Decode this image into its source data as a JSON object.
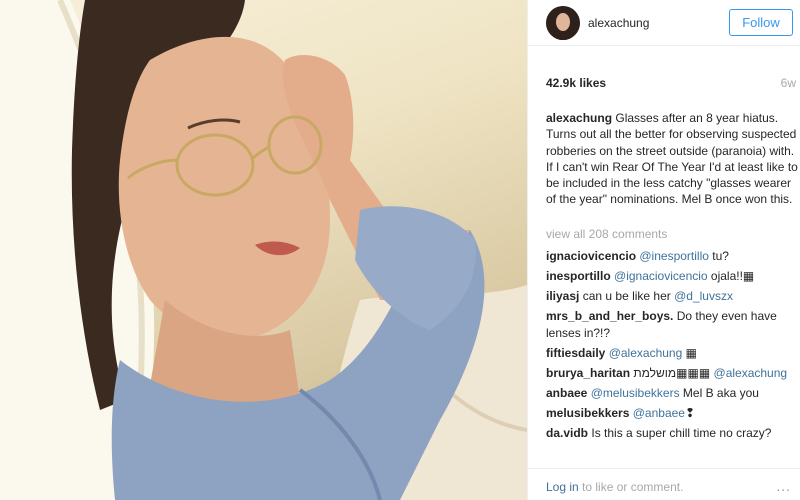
{
  "post": {
    "username": "alexachung",
    "follow_label": "Follow",
    "likes": "42.9k likes",
    "time_ago": "6w",
    "caption": {
      "user": "alexachung",
      "text": "Glasses after an 8 year hiatus. Turns out all the better for observing suspected robberies on the street outside (paranoia) with. If I can't win Rear Of The Year I'd at least like to be included in the less catchy \"glasses wearer of the year\" nominations. Mel B once won this."
    },
    "view_all": "view all 208 comments",
    "comments": [
      {
        "user": "ignaciovicencio",
        "mention": "@inesportillo",
        "text": " tu?"
      },
      {
        "user": "inesportillo",
        "mention": "@ignaciovicencio",
        "text": " ojala!!▦"
      },
      {
        "user": "iliyasj",
        "text": "can u be like her ",
        "mention": "@d_luvszx",
        "text2": ""
      },
      {
        "user": "mrs_b_and_her_boys.",
        "text": "Do they even have lenses in?!?"
      },
      {
        "user": "fiftiesdaily",
        "mention": "@alexachung",
        "text": " ▦"
      },
      {
        "user": "brurya_haritan",
        "text": "מושלמת▦▦▦ ",
        "mention": "@alexachung"
      },
      {
        "user": "anbaee",
        "mention": "@melusibekkers",
        "text": " Mel B aka you"
      },
      {
        "user": "melusibekkers",
        "mention": "@anbaee",
        "text": "❢"
      },
      {
        "user": "da.vidb",
        "text": "Is this a super chill time no crazy?"
      }
    ],
    "footer": {
      "login_link": "Log in",
      "login_suffix": " to like or comment.",
      "more": "..."
    }
  }
}
